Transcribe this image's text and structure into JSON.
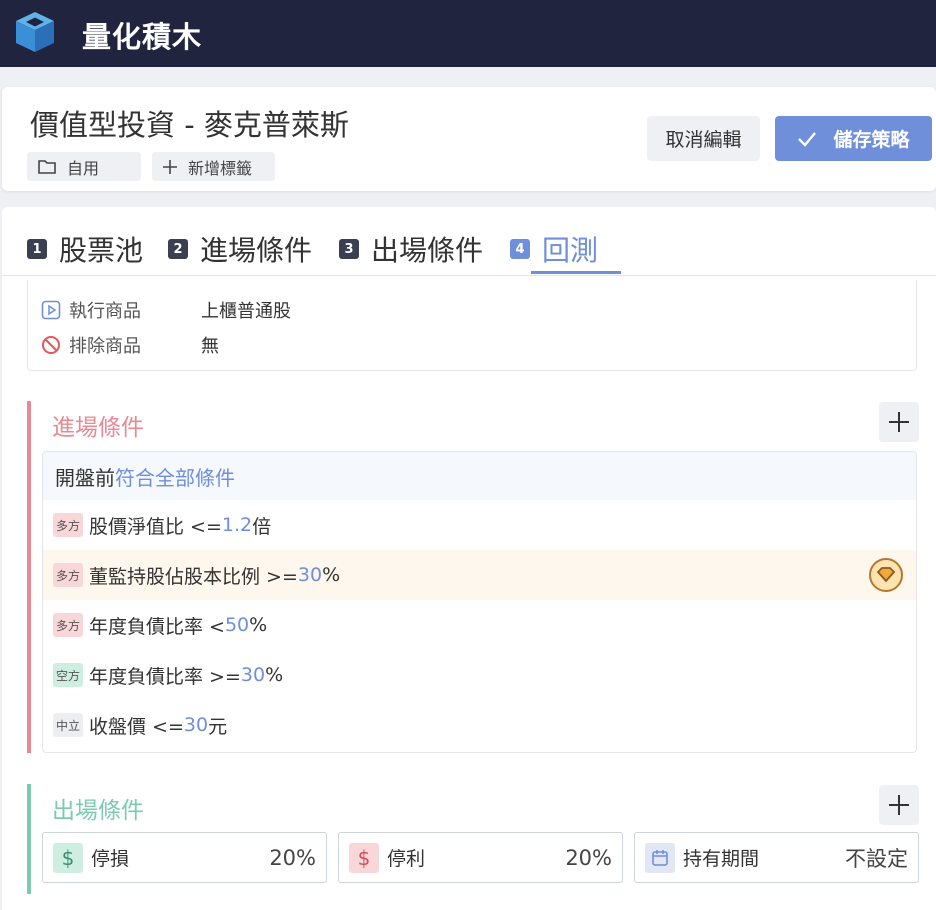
{
  "app": {
    "title": "量化積木"
  },
  "strategy": {
    "title": "價值型投資 - 麥克普萊斯",
    "tags": [
      "自用",
      "新增標籤"
    ],
    "cancel_label": "取消編輯",
    "save_label": "儲存策略"
  },
  "tabs": [
    {
      "num": "1",
      "label": "股票池",
      "active": false
    },
    {
      "num": "2",
      "label": "進場條件",
      "active": false
    },
    {
      "num": "3",
      "label": "出場條件",
      "active": false
    },
    {
      "num": "4",
      "label": "回測",
      "active": true
    }
  ],
  "pool": {
    "rows": [
      {
        "key": "執行商品",
        "value": "上櫃普通股",
        "icon": "play-icon"
      },
      {
        "key": "排除商品",
        "value": "無",
        "icon": "ban-icon"
      }
    ]
  },
  "entry": {
    "title": "進場條件",
    "head_prefix": "開盤前",
    "head_highlight": "符合全部條件",
    "conditions": [
      {
        "tag": "多方",
        "pre": "股價淨值比 <= ",
        "num": "1.2",
        "post": "倍"
      },
      {
        "tag": "多方",
        "pre": "董監持股佔股本比例 >= ",
        "num": "30",
        "post": "%"
      },
      {
        "tag": "多方",
        "pre": "年度負債比率 < ",
        "num": "50",
        "post": "%"
      },
      {
        "tag": "空方",
        "pre": "年度負債比率 >= ",
        "num": "30",
        "post": "%"
      },
      {
        "tag": "中立",
        "pre": "收盤價 <= ",
        "num": "30",
        "post": "元"
      }
    ]
  },
  "exit": {
    "title": "出場條件",
    "items": [
      {
        "label": "停損",
        "value": "20%",
        "icon": "dollar-icon"
      },
      {
        "label": "停利",
        "value": "20%",
        "icon": "dollar-icon"
      },
      {
        "label": "持有期間",
        "value": "不設定",
        "icon": "calendar-icon"
      }
    ]
  },
  "colors": {
    "topbar": "#20243f",
    "accent": "#6f8fdb",
    "entry": "#e88a93",
    "exit": "#7ccbb0"
  }
}
